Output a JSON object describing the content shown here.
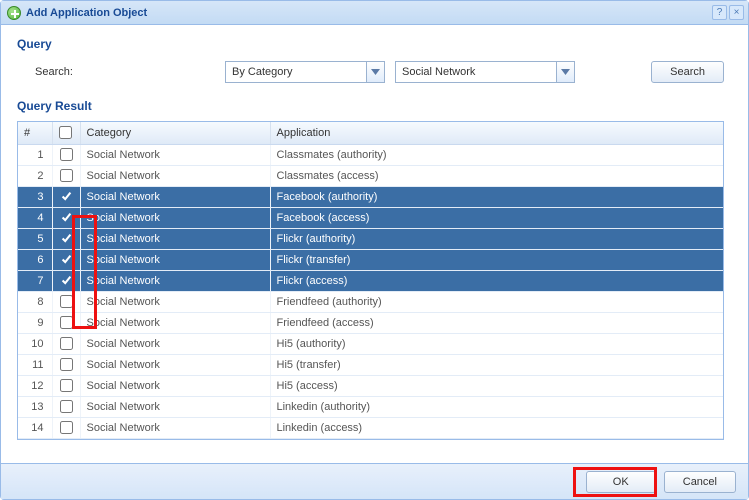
{
  "window": {
    "title": "Add Application Object",
    "help_tooltip": "?",
    "close_tooltip": "×"
  },
  "query": {
    "section_label": "Query",
    "search_label": "Search:",
    "mode_value": "By Category",
    "category_value": "Social Network",
    "search_button": "Search"
  },
  "result": {
    "section_label": "Query Result",
    "columns": {
      "num": "#",
      "category": "Category",
      "application": "Application"
    },
    "rows": [
      {
        "n": 1,
        "checked": false,
        "selected": false,
        "category": "Social Network",
        "application": "Classmates (authority)"
      },
      {
        "n": 2,
        "checked": false,
        "selected": false,
        "category": "Social Network",
        "application": "Classmates (access)"
      },
      {
        "n": 3,
        "checked": true,
        "selected": true,
        "category": "Social Network",
        "application": "Facebook (authority)"
      },
      {
        "n": 4,
        "checked": true,
        "selected": true,
        "category": "Social Network",
        "application": "Facebook (access)"
      },
      {
        "n": 5,
        "checked": true,
        "selected": true,
        "category": "Social Network",
        "application": "Flickr (authority)"
      },
      {
        "n": 6,
        "checked": true,
        "selected": true,
        "category": "Social Network",
        "application": "Flickr (transfer)"
      },
      {
        "n": 7,
        "checked": true,
        "selected": true,
        "category": "Social Network",
        "application": "Flickr (access)"
      },
      {
        "n": 8,
        "checked": false,
        "selected": false,
        "category": "Social Network",
        "application": "Friendfeed (authority)"
      },
      {
        "n": 9,
        "checked": false,
        "selected": false,
        "category": "Social Network",
        "application": "Friendfeed (access)"
      },
      {
        "n": 10,
        "checked": false,
        "selected": false,
        "category": "Social Network",
        "application": "Hi5 (authority)"
      },
      {
        "n": 11,
        "checked": false,
        "selected": false,
        "category": "Social Network",
        "application": "Hi5 (transfer)"
      },
      {
        "n": 12,
        "checked": false,
        "selected": false,
        "category": "Social Network",
        "application": "Hi5 (access)"
      },
      {
        "n": 13,
        "checked": false,
        "selected": false,
        "category": "Social Network",
        "application": "Linkedin (authority)"
      },
      {
        "n": 14,
        "checked": false,
        "selected": false,
        "category": "Social Network",
        "application": "Linkedin (access)"
      }
    ]
  },
  "footer": {
    "ok": "OK",
    "cancel": "Cancel"
  }
}
